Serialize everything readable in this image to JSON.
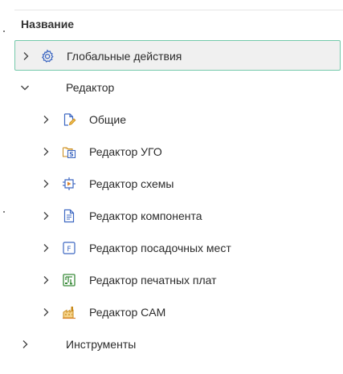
{
  "tree": {
    "header": "Название",
    "items": [
      {
        "label": "Глобальные действия",
        "icon": "gear-icon",
        "expanded": false,
        "selected": true
      },
      {
        "label": "Редактор",
        "icon": null,
        "expanded": true,
        "selected": false,
        "children": [
          {
            "label": "Общие",
            "icon": "document-pencil-icon",
            "expanded": false
          },
          {
            "label": "Редактор УГО",
            "icon": "symbol-folder-icon",
            "expanded": false
          },
          {
            "label": "Редактор схемы",
            "icon": "schematic-icon",
            "expanded": false
          },
          {
            "label": "Редактор компонента",
            "icon": "component-document-icon",
            "expanded": false
          },
          {
            "label": "Редактор посадочных мест",
            "icon": "footprint-icon",
            "expanded": false
          },
          {
            "label": "Редактор печатных плат",
            "icon": "pcb-board-icon",
            "expanded": false
          },
          {
            "label": "Редактор CAM",
            "icon": "cam-factory-icon",
            "expanded": false
          }
        ]
      },
      {
        "label": "Инструменты",
        "icon": null,
        "expanded": false,
        "selected": false
      }
    ]
  },
  "colors": {
    "selection_border": "#74c9aa",
    "selection_bg": "#f0f0f0",
    "icon_blue": "#3e68c2",
    "icon_orange": "#d9822b",
    "icon_green": "#3c8c3c"
  }
}
